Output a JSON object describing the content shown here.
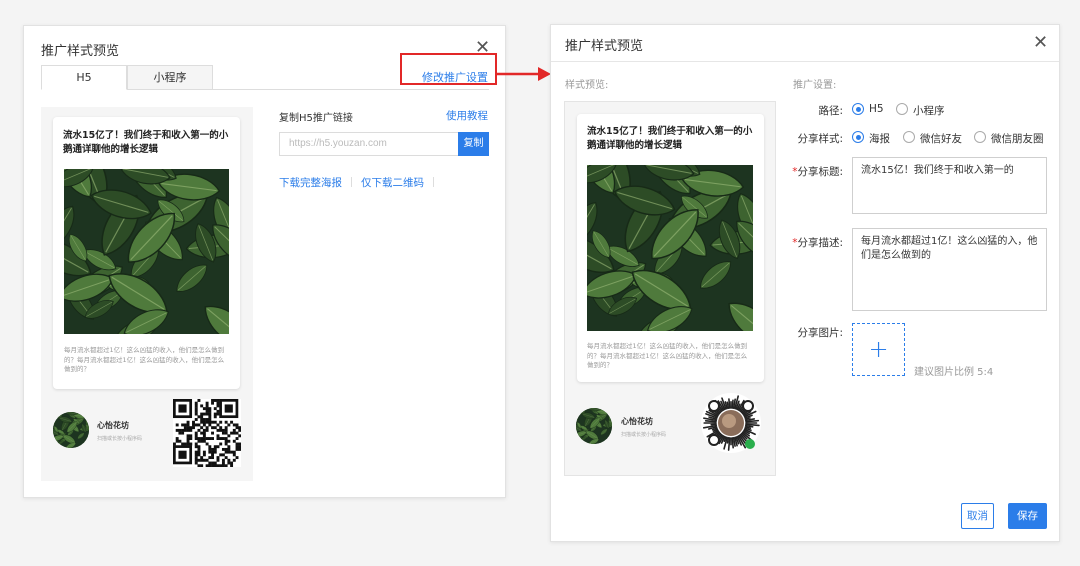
{
  "left_dialog": {
    "title": "推广样式预览",
    "close": "✕",
    "tabs": [
      {
        "label": "H5",
        "active": true
      },
      {
        "label": "小程序",
        "active": false
      }
    ],
    "modify_link": "修改推广设置",
    "copy_link_label": "复制H5推广链接",
    "tutorial_link": "使用教程",
    "url_value": "https://h5.youzan.com",
    "copy_button": "复制",
    "download_poster": "下载完整海报",
    "download_qr": "仅下载二维码"
  },
  "right_dialog": {
    "title": "推广样式预览",
    "close": "✕",
    "style_preview_label": "样式预览:",
    "settings_label": "推广设置:",
    "path_label": "路径:",
    "path_options": [
      {
        "label": "H5",
        "selected": true
      },
      {
        "label": "小程序",
        "selected": false
      }
    ],
    "share_style_label": "分享样式:",
    "share_style_options": [
      {
        "label": "海报",
        "selected": true
      },
      {
        "label": "微信好友",
        "selected": false
      },
      {
        "label": "微信朋友圈",
        "selected": false
      }
    ],
    "share_title_label": "分享标题:",
    "share_title_value": "流水15亿！我们终于和收入第一的",
    "share_desc_label": "分享描述:",
    "share_desc_value": "每月流水都超过1亿！这么凶猛的入，他们是怎么做到的",
    "share_image_label": "分享图片:",
    "upload_plus": "+",
    "image_hint": "建议图片比例 5:4",
    "cancel_button": "取消",
    "save_button": "保存"
  },
  "poster": {
    "title": "流水15亿了！我们终于和收入第一的小鹅通详聊他的增长逻辑",
    "description": "每月流水都超过1亿！这么凶猛的收入，他们是怎么做到的？每月流水都超过1亿！这么凶猛的收入，他们是怎么做到的？",
    "shop_name": "心怡花坊",
    "left_shop_sub": "扫描或长按小程序码",
    "right_shop_sub": "扫描或长按小程序码"
  },
  "colors": {
    "accent": "#2b7de9",
    "highlight": "#e22828",
    "leaf_dark": "#1d3420",
    "leaf_light": "#4f7a3c"
  },
  "icons": {
    "close": "close-icon",
    "arrow": "red-arrow-icon",
    "qr": "qr-code-icon",
    "mini_program_code": "mini-program-code-icon"
  }
}
